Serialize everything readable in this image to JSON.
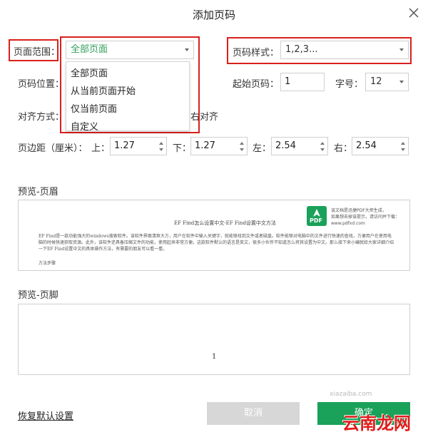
{
  "dialog": {
    "title": "添加页码"
  },
  "page_range": {
    "label": "页面范围：",
    "value": "全部页面",
    "options": [
      "全部页面",
      "从当前页面开始",
      "仅当前页面",
      "自定义"
    ]
  },
  "number_style": {
    "label": "页码样式：",
    "value": "1,2,3..."
  },
  "number_position": {
    "label": "页码位置："
  },
  "start_number": {
    "label": "起始页码：",
    "value": "1"
  },
  "font_size": {
    "label": "字号：",
    "value": "12"
  },
  "alignment": {
    "label": "对齐方式：",
    "right_label": "右对齐"
  },
  "margins": {
    "label": "页边距（厘米）：",
    "top_label": "上：",
    "top_value": "1.27",
    "bottom_label": "下：",
    "bottom_value": "1.27",
    "left_label": "左：",
    "left_value": "2.54",
    "right_label": "右：",
    "right_value": "2.54"
  },
  "preview_header": {
    "label": "预览-页眉",
    "doc_title": "EF Find怎么设置中文-EF Find设置中文方法",
    "doc_para": "EF Find是一款功能强大的windows搜索软件。该软件界面清爽大方，用户在软件中输入关键字，就能够找到文件或者磁盘。软件能够对电脑中的文件进行快速的查找，方便用户在使用电脑的时候快速获取资源。此外，该软件还具备压缩文件的功能，使用起来非常方便。这款软件默认的语言是英文，很多小伙伴不知道怎么将其设置为中文。那么接下来小编就给大家详细介绍一下EF Find设置中文的具体操作方法，有需要的朋友可以看一看。",
    "doc_steps": "方法步骤",
    "pdf_badge": "PDF",
    "notice_1": "该文档是迅捷PDF大师生成，",
    "notice_2": "如果想去掉该提示，请访问并下载：",
    "notice_3": "www.pdfxd.com"
  },
  "preview_footer": {
    "label": "预览-页脚",
    "page_number": "1"
  },
  "buttons": {
    "reset": "恢复默认设置",
    "cancel": "取消",
    "ok": "确定"
  },
  "watermarks": {
    "site_cn": "云南龙网",
    "site_latin": "xiazaiba.com"
  },
  "colors": {
    "highlight_red": "#d9201c",
    "accent_green": "#1aa15a"
  }
}
